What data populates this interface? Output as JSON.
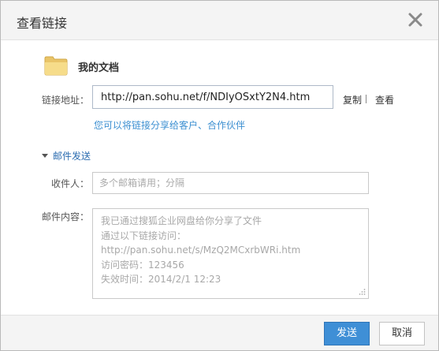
{
  "dialog": {
    "title": "查看链接",
    "close_icon": "close-icon"
  },
  "file": {
    "icon": "folder-icon",
    "name": "我的文档"
  },
  "link": {
    "label": "链接地址：",
    "url": "http://pan.sohu.net/f/NDIyOSxtY2N4.htm",
    "copy_label": "复制",
    "view_label": "查看",
    "share_tip": "您可以将链接分享给客户、合作伙伴"
  },
  "mail": {
    "toggle_label": "邮件发送",
    "toggle_icon": "triangle-down-icon",
    "to_label": "收件人：",
    "to_placeholder": "多个邮箱请用；分隔",
    "to_value": "",
    "content_label": "邮件内容：",
    "content_lines": [
      "我已通过搜狐企业网盘给你分享了文件",
      "通过以下链接访问：",
      "http://pan.sohu.net/s/MzQ2MCxrbWRi.htm",
      "访问密码：123456",
      "失效时间：2014/2/1 12:23"
    ]
  },
  "footer": {
    "send_label": "发送",
    "cancel_label": "取消"
  },
  "colors": {
    "primary_button": "#3f8fd6",
    "link_text": "#3c8fd1",
    "folder": "#f3d57d"
  }
}
